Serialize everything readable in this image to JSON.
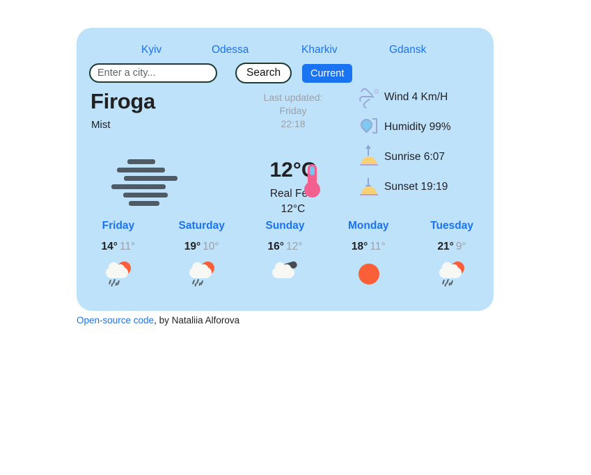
{
  "nav": {
    "cities": [
      {
        "label": "Kyiv"
      },
      {
        "label": "Odessa"
      },
      {
        "label": "Kharkiv"
      },
      {
        "label": "Gdansk"
      }
    ]
  },
  "search": {
    "placeholder": "Enter a city...",
    "value": "",
    "search_label": "Search",
    "current_label": "Current"
  },
  "current": {
    "city": "Firoga",
    "description": "Mist",
    "icon": "fog-icon",
    "updated_label": "Last updated:",
    "updated_day": "Friday",
    "updated_time": "22:18",
    "temperature": "12°C",
    "real_feel_label": "Real Feel",
    "real_feel_value": "12°C",
    "thermometer_icon": "thermometer-icon"
  },
  "details": [
    {
      "icon": "wind-icon",
      "text": "Wind 4 Km/H"
    },
    {
      "icon": "humidity-icon",
      "text": "Humidity 99%"
    },
    {
      "icon": "sunrise-icon",
      "text": "Sunrise 6:07"
    },
    {
      "icon": "sunset-icon",
      "text": "Sunset 19:19"
    }
  ],
  "forecast": [
    {
      "day": "Friday",
      "max": "14°",
      "min": "11°",
      "icon": "sun-rain-icon"
    },
    {
      "day": "Saturday",
      "max": "19°",
      "min": "10°",
      "icon": "sun-rain-icon"
    },
    {
      "day": "Sunday",
      "max": "16°",
      "min": "12°",
      "icon": "cloud-icon"
    },
    {
      "day": "Monday",
      "max": "18°",
      "min": "11°",
      "icon": "sun-icon"
    },
    {
      "day": "Tuesday",
      "max": "21°",
      "min": "9°",
      "icon": "sun-rain-icon"
    }
  ],
  "footer": {
    "link_text": "Open-source code",
    "rest_text": ", by Nataliia Alforova"
  },
  "colors": {
    "card_background": "#bfe2fb",
    "page_background": "#ffffff",
    "accent_blue": "#1a73f0",
    "muted_text": "#9aa0a6",
    "dark_text": "#212121",
    "input_border": "#68d4bd",
    "sun_orange": "#fa5f38"
  }
}
